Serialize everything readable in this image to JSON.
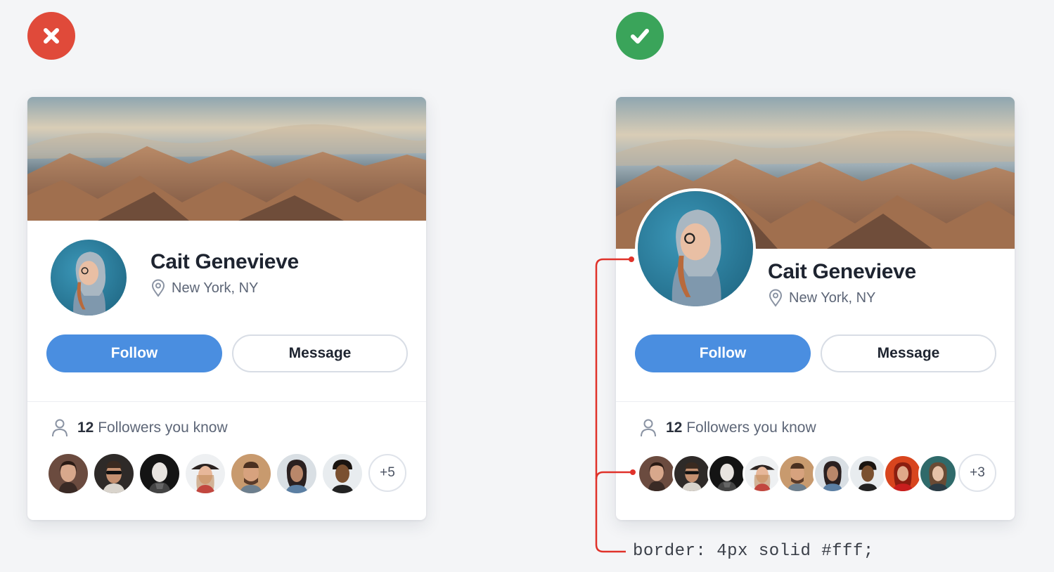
{
  "examples": [
    {
      "verdict": "incorrect",
      "verdict_icon": "x-icon",
      "profile": {
        "name": "Cait Genevieve",
        "location": "New York, NY",
        "follow_label": "Follow",
        "message_label": "Message",
        "followers_count": "12",
        "followers_text": "Followers you know",
        "more_count": "+5",
        "follower_avatars": 7
      }
    },
    {
      "verdict": "correct",
      "verdict_icon": "check-icon",
      "profile": {
        "name": "Cait Genevieve",
        "location": "New York, NY",
        "follow_label": "Follow",
        "message_label": "Message",
        "followers_count": "12",
        "followers_text": "Followers you know",
        "more_count": "+3",
        "follower_avatars": 9
      },
      "annotation": "border: 4px solid #fff;"
    }
  ],
  "colors": {
    "incorrect": "#e04a3a",
    "correct": "#3aa45a",
    "follow_button": "#4a8ee0",
    "annotation_line": "#e0322a"
  }
}
